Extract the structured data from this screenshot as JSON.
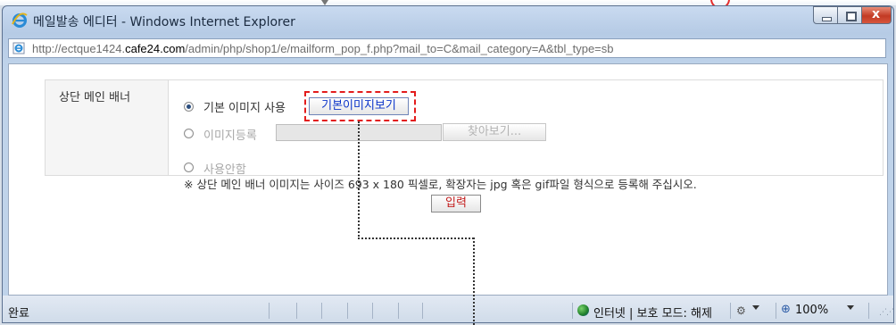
{
  "window": {
    "title": "메일발송 에디터 - Windows Internet Explorer",
    "close_glyph": "x"
  },
  "address": {
    "url_prefix": "http://ectque1424.",
    "url_domain": "cafe24.com",
    "url_suffix": "/admin/php/shop1/e/mailform_pop_f.php?mail_to=C&mail_category=A&tbl_type=sb"
  },
  "form": {
    "label": "상단 메인 배너",
    "option_default": "기본 이미지 사용",
    "view_default_button": "기본이미지보기",
    "option_register": "이미지등록",
    "browse_button": "찾아보기...",
    "option_none": "사용안함",
    "note": "※ 상단 메인 배너 이미지는 사이즈 693 x 180 픽셀로, 확장자는 jpg 혹은 gif파일 형식으로 등록해 주십시오.",
    "submit_button": "입력",
    "selected_option": "option_default"
  },
  "status": {
    "left": "완료",
    "zone": "인터넷 | 보호 모드: 해제",
    "zoom": "100%"
  },
  "icons": {
    "browser": "ie-logo-icon",
    "page": "ie-page-icon",
    "zone": "globe-icon",
    "zoom": "magnifier-icon"
  },
  "colors": {
    "highlight": "#e31c1c",
    "link_button": "#0a33c9"
  }
}
